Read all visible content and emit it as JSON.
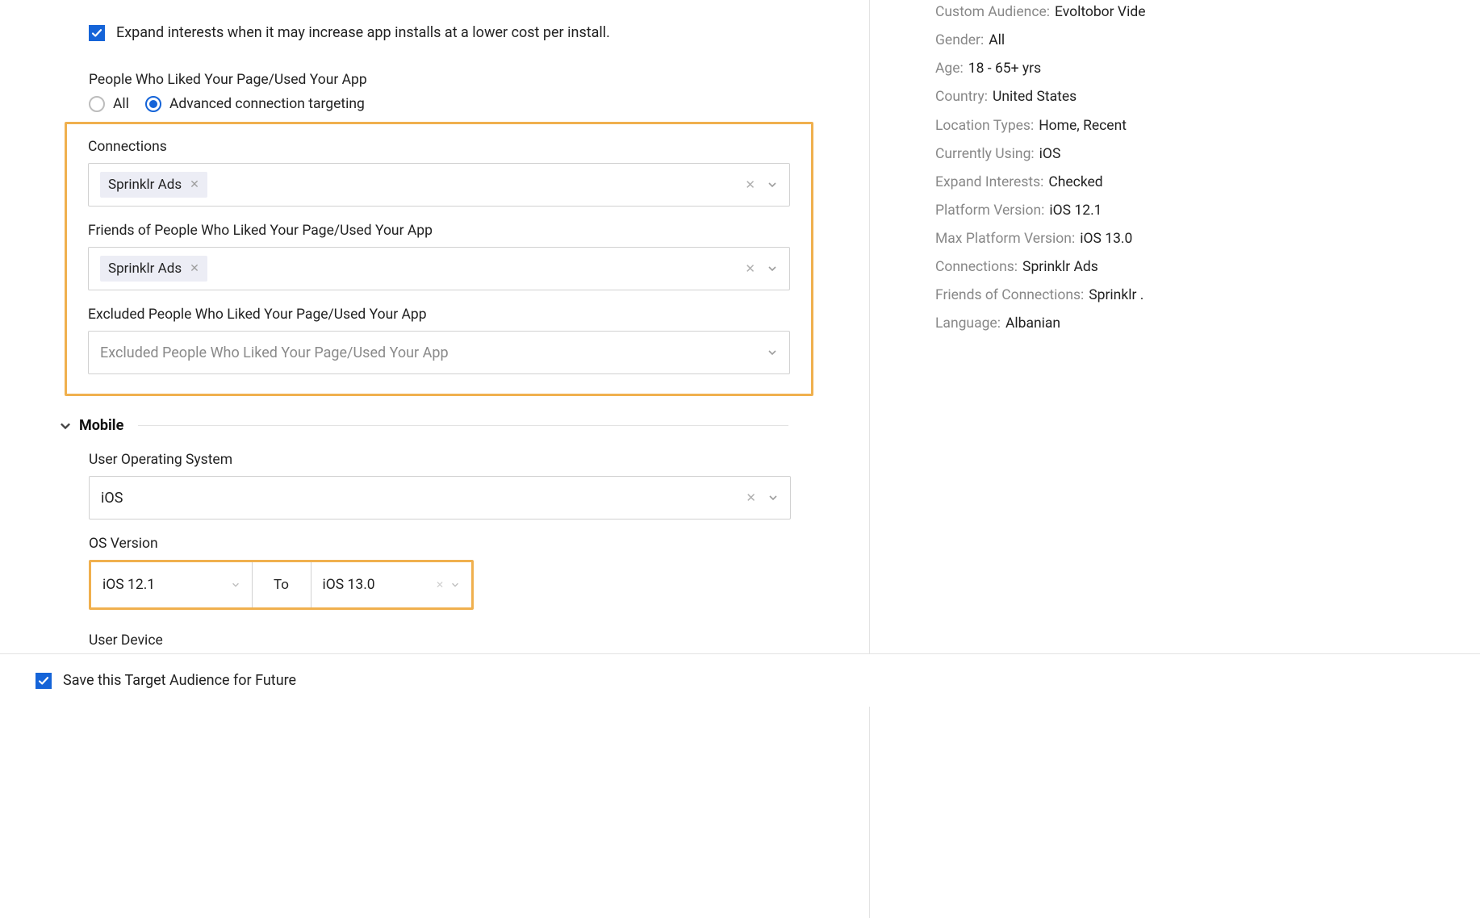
{
  "expand_interests": {
    "checked": true,
    "label": "Expand interests when it may increase app installs at a lower cost per install."
  },
  "people_section": {
    "heading": "People Who Liked Your Page/Used Your App",
    "radio_all": "All",
    "radio_advanced": "Advanced connection targeting",
    "selected": "advanced"
  },
  "connections": {
    "label": "Connections",
    "chips": [
      "Sprinklr Ads"
    ]
  },
  "friends": {
    "label": "Friends of People Who Liked Your Page/Used Your App",
    "chips": [
      "Sprinklr Ads"
    ]
  },
  "excluded": {
    "label": "Excluded People Who Liked Your Page/Used Your App",
    "placeholder": "Excluded People Who Liked Your Page/Used Your App"
  },
  "mobile": {
    "title": "Mobile",
    "user_os_label": "User Operating System",
    "user_os_value": "iOS",
    "os_version_label": "OS Version",
    "os_from": "iOS 12.1",
    "os_to_word": "To",
    "os_to": "iOS 13.0",
    "user_device_label": "User Device"
  },
  "footer": {
    "save_label": "Save this Target Audience for Future"
  },
  "summary": {
    "custom_audience": {
      "key": "Custom Audience:",
      "val": "Evoltobor Vide"
    },
    "gender": {
      "key": "Gender:",
      "val": "All"
    },
    "age": {
      "key": "Age:",
      "val": "18 - 65+ yrs"
    },
    "country": {
      "key": "Country:",
      "val": "United States"
    },
    "location_types": {
      "key": "Location Types:",
      "val": "Home, Recent"
    },
    "currently_using": {
      "key": "Currently Using:",
      "val": "iOS"
    },
    "expand_interests": {
      "key": "Expand Interests:",
      "val": "Checked"
    },
    "platform_version": {
      "key": "Platform Version:",
      "val": "iOS 12.1"
    },
    "max_platform_version": {
      "key": "Max Platform Version:",
      "val": "iOS 13.0"
    },
    "connections": {
      "key": "Connections:",
      "val": "Sprinklr Ads"
    },
    "friends_connections": {
      "key": "Friends of Connections:",
      "val": "Sprinklr ."
    },
    "language": {
      "key": "Language:",
      "val": "Albanian"
    }
  }
}
